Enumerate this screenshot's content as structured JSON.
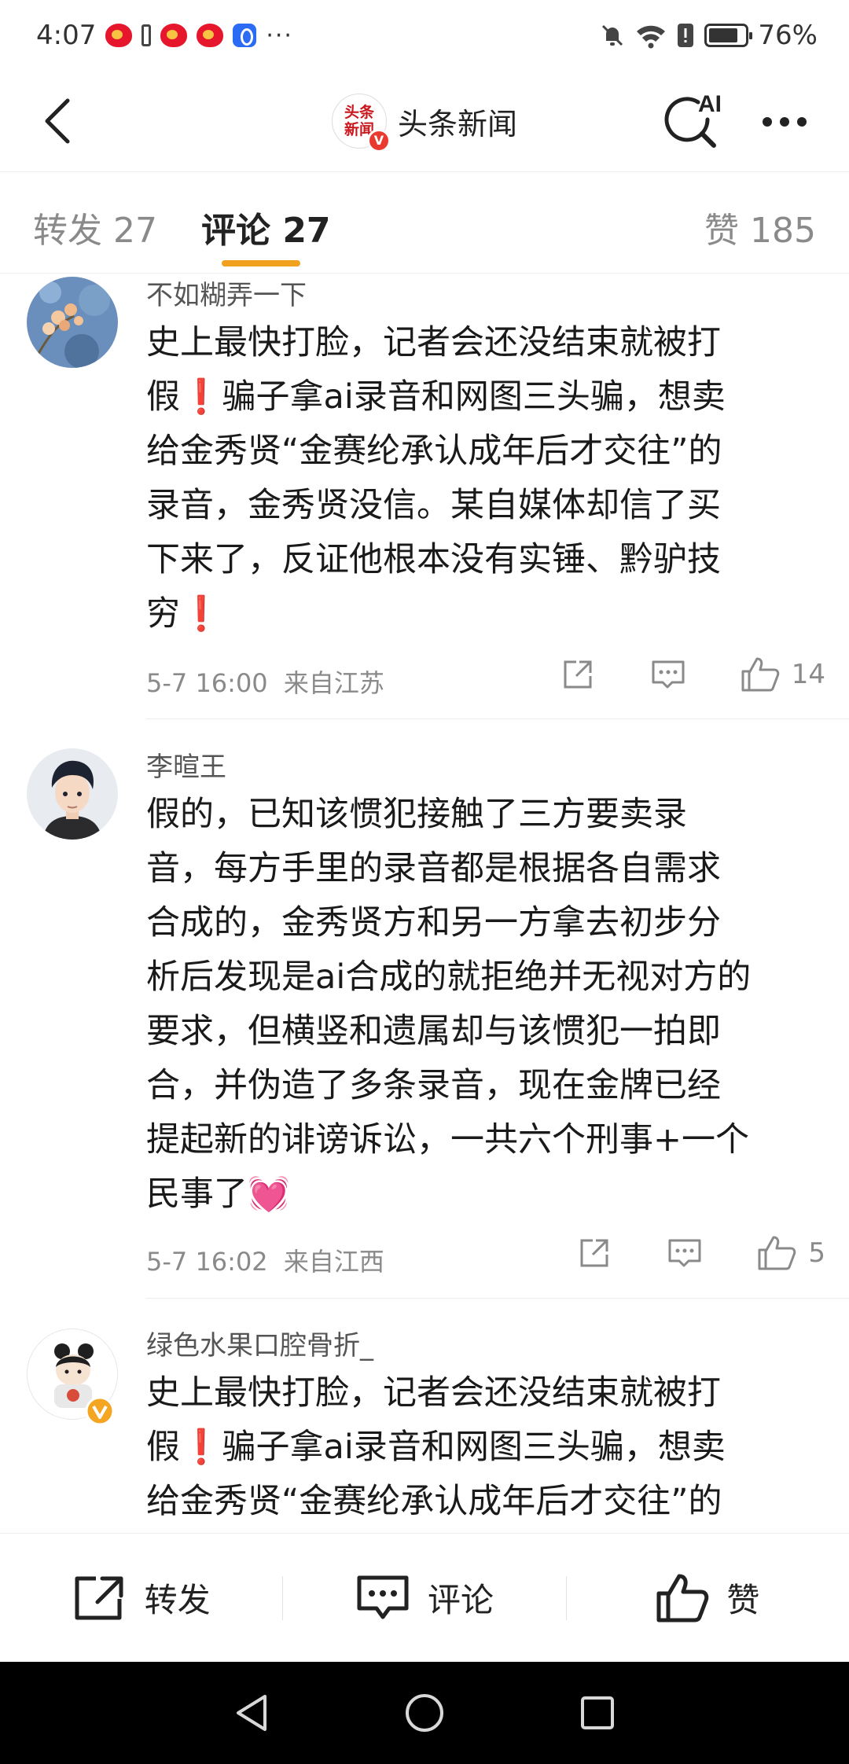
{
  "status_bar": {
    "time": "4:07",
    "overflow_dots": "···",
    "battery": "76%"
  },
  "header": {
    "source_logo_text": "头条新闻",
    "source_verified": "V",
    "source_name": "头条新闻",
    "ai_label": "AI"
  },
  "tabs": {
    "repost": "转发 27",
    "comment": "评论 27",
    "like": "赞 185",
    "active": "comment",
    "accent_color": "#f0a11e"
  },
  "comments": [
    {
      "username": "不如糊弄一下",
      "lines": [
        "史上最快打脸，记者会还没结束就被打",
        "假❗骗子拿ai录音和网图三头骗，想卖",
        "给金秀贤“金赛纶承认成年后才交往”的",
        "录音，金秀贤没信。某自媒体却信了买",
        "下来了，反证他根本没有实锤、黔驴技",
        "穷❗"
      ],
      "date": "5-7 16:00",
      "location": "来自江苏",
      "likes": "14"
    },
    {
      "username": "李暄王",
      "lines": [
        "假的，已知该惯犯接触了三方要卖录",
        "音，每方手里的录音都是根据各自需求",
        "合成的，金秀贤方和另一方拿去初步分",
        "析后发现是ai合成的就拒绝并无视对方的",
        "要求，但横竖和遗属却与该惯犯一拍即",
        "合，并伪造了多条录音，现在金牌已经",
        "提起新的诽谤诉讼，一共六个刑事+一个",
        "民事了💓"
      ],
      "date": "5-7 16:02",
      "location": "来自江西",
      "likes": "5"
    },
    {
      "username": "绿色水果口腔骨折_",
      "lines": [
        "史上最快打脸，记者会还没结束就被打",
        "假❗骗子拿ai录音和网图三头骗，想卖",
        "给金秀贤“金赛纶承认成年后才交往”的"
      ]
    }
  ],
  "bottom_bar": {
    "repost": "转发",
    "comment": "评论",
    "like": "赞"
  }
}
